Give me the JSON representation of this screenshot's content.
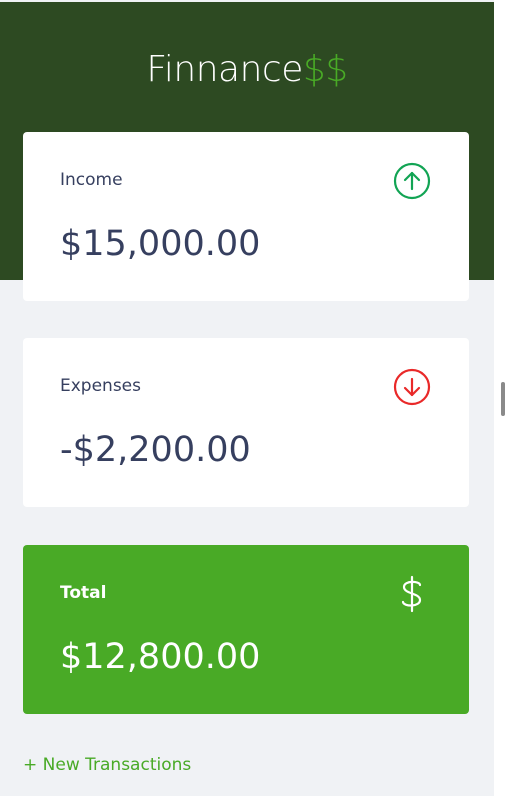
{
  "app": {
    "logo_text": "Finnance",
    "logo_accent": "$$"
  },
  "cards": {
    "income": {
      "label": "Income",
      "amount": "$15,000.00",
      "icon": "arrow-up-circle-icon"
    },
    "expenses": {
      "label": "Expenses",
      "amount": "-$2,200.00",
      "icon": "arrow-down-circle-icon"
    },
    "total": {
      "label": "Total",
      "amount": "$12,800.00",
      "icon": "dollar-icon"
    }
  },
  "actions": {
    "new_transaction": "+ New Transactions"
  },
  "colors": {
    "header_bg": "#2d4a22",
    "accent_green": "#49aa26",
    "income_icon": "#12a454",
    "expense_icon": "#e92929",
    "text_dark": "#363f5f",
    "page_bg": "#f0f2f5"
  }
}
